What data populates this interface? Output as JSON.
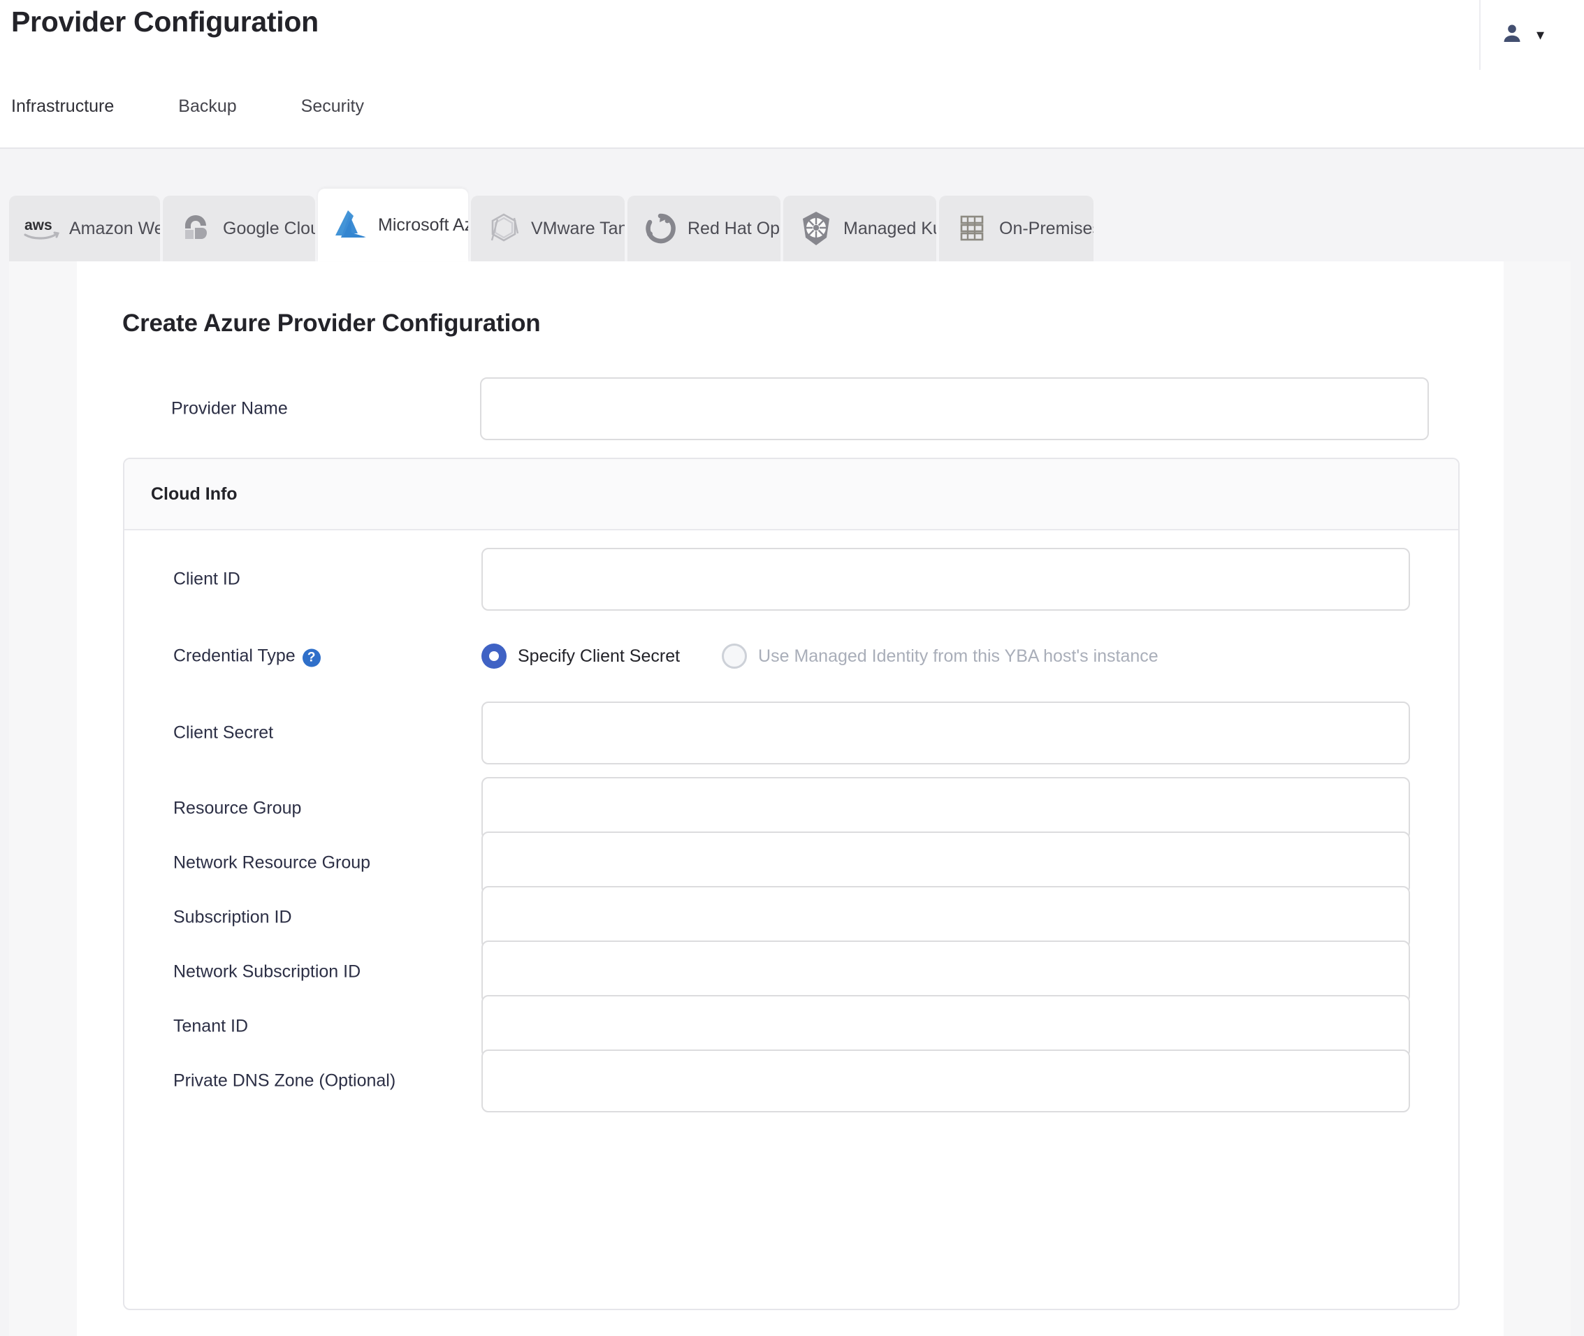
{
  "header": {
    "title": "Provider Configuration",
    "account_icon": "user-icon",
    "chevron_icon": "chevron-down-icon",
    "tabs": [
      {
        "label": "Infrastructure",
        "active": true
      },
      {
        "label": "Backup",
        "active": false
      },
      {
        "label": "Security",
        "active": false
      }
    ],
    "active_underline_color": "#E05A30"
  },
  "provider_tabs": [
    {
      "label": "Amazon Web...",
      "icon": "aws-icon",
      "selected": false
    },
    {
      "label": "Google Clou...",
      "icon": "google-cloud-icon",
      "selected": false
    },
    {
      "label": "Microsoft Az...",
      "icon": "microsoft-azure-icon",
      "selected": true
    },
    {
      "label": "VMware Tanzu",
      "icon": "vmware-tanzu-icon",
      "selected": false
    },
    {
      "label": "Red Hat Ope...",
      "icon": "red-hat-openshift-icon",
      "selected": false
    },
    {
      "label": "Managed Ku...",
      "icon": "kubernetes-icon",
      "selected": false
    },
    {
      "label": "On-Premises D...",
      "icon": "on-premises-datacenter-icon",
      "selected": false
    }
  ],
  "form": {
    "title": "Create Azure Provider Configuration",
    "provider_name": {
      "label": "Provider Name",
      "value": "",
      "placeholder": ""
    },
    "cloud_info": {
      "section_title": "Cloud Info",
      "credential_type": {
        "label": "Credential Type",
        "help_icon": "help-icon",
        "help_glyph": "?",
        "options": [
          {
            "label": "Specify Client Secret",
            "selected": true,
            "disabled": false
          },
          {
            "label": "Use Managed Identity from this YBA host's instance",
            "selected": false,
            "disabled": true
          }
        ]
      },
      "fields": [
        {
          "label": "Client ID",
          "value": "",
          "placeholder": ""
        },
        {
          "label": "Client Secret",
          "value": "",
          "placeholder": ""
        },
        {
          "label": "Resource Group",
          "value": "",
          "placeholder": ""
        },
        {
          "label": "Network Resource Group",
          "value": "",
          "placeholder": ""
        },
        {
          "label": "Subscription ID",
          "value": "",
          "placeholder": ""
        },
        {
          "label": "Network Subscription ID",
          "value": "",
          "placeholder": ""
        },
        {
          "label": "Tenant ID",
          "value": "",
          "placeholder": ""
        },
        {
          "label": "Private DNS Zone (Optional)",
          "value": "",
          "placeholder": ""
        }
      ]
    }
  },
  "colors": {
    "accent_orange": "#E05A30",
    "radio_blue": "#3F62C4",
    "help_blue": "#2F6FC9",
    "azure_blue": "#3C8CD4",
    "text_dark": "#232329",
    "label_text": "#2C2F45",
    "disabled_text": "#A9AEB9"
  }
}
